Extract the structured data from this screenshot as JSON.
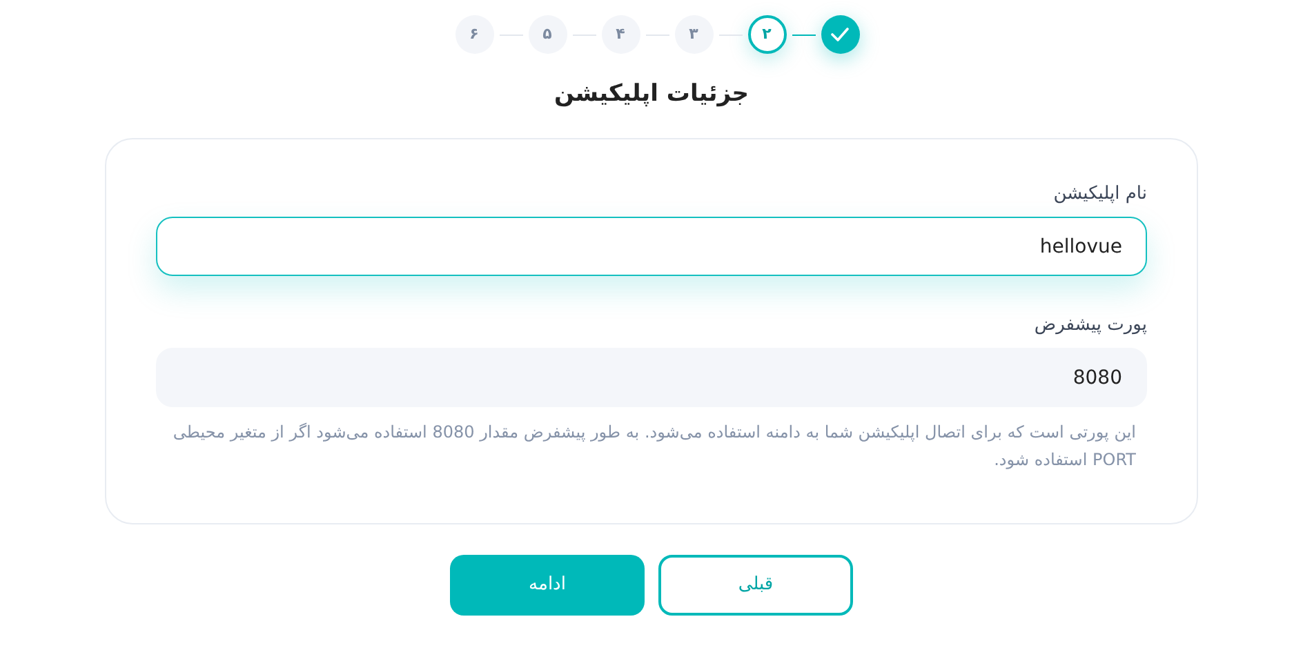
{
  "steps": [
    {
      "completed": true,
      "selected": false
    },
    {
      "label": "۲",
      "completed": false,
      "selected": true
    },
    {
      "label": "۳",
      "completed": false,
      "selected": false
    },
    {
      "label": "۴",
      "completed": false,
      "selected": false
    },
    {
      "label": "۵",
      "completed": false,
      "selected": false
    },
    {
      "label": "۶",
      "completed": false,
      "selected": false
    }
  ],
  "title": "جزئیات اپلیکیشن",
  "fields": [
    {
      "label": "نام اپلیکیشن",
      "value": "hellovue",
      "focused": true
    },
    {
      "label": "پورت پیشفرض",
      "value": "8080",
      "focused": false,
      "help": "این پورتی است که برای اتصال اپلیکیشن شما به دامنه استفاده می‌شود. به طور پیشفرض مقدار 8080 استفاده می‌شود اگر از متغیر محیطی PORT استفاده شود."
    }
  ],
  "buttons": [
    {
      "label": "قبلی",
      "kind": "secondary"
    },
    {
      "label": "ادامه",
      "kind": "primary"
    }
  ]
}
